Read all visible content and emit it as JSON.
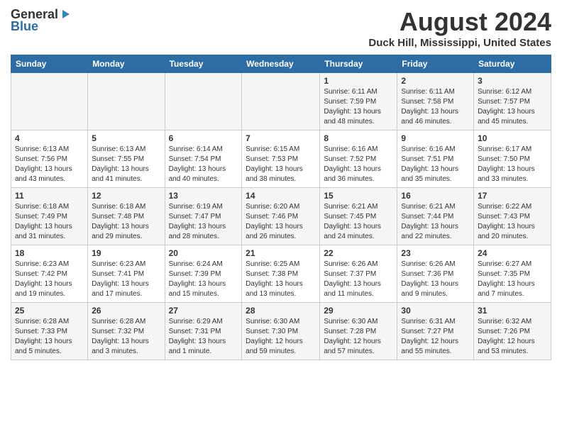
{
  "header": {
    "logo_general": "General",
    "logo_blue": "Blue",
    "month_year": "August 2024",
    "location": "Duck Hill, Mississippi, United States"
  },
  "weekdays": [
    "Sunday",
    "Monday",
    "Tuesday",
    "Wednesday",
    "Thursday",
    "Friday",
    "Saturday"
  ],
  "weeks": [
    [
      {
        "day": "",
        "sunrise": "",
        "sunset": "",
        "daylight": ""
      },
      {
        "day": "",
        "sunrise": "",
        "sunset": "",
        "daylight": ""
      },
      {
        "day": "",
        "sunrise": "",
        "sunset": "",
        "daylight": ""
      },
      {
        "day": "",
        "sunrise": "",
        "sunset": "",
        "daylight": ""
      },
      {
        "day": "1",
        "sunrise": "Sunrise: 6:11 AM",
        "sunset": "Sunset: 7:59 PM",
        "daylight": "Daylight: 13 hours and 48 minutes."
      },
      {
        "day": "2",
        "sunrise": "Sunrise: 6:11 AM",
        "sunset": "Sunset: 7:58 PM",
        "daylight": "Daylight: 13 hours and 46 minutes."
      },
      {
        "day": "3",
        "sunrise": "Sunrise: 6:12 AM",
        "sunset": "Sunset: 7:57 PM",
        "daylight": "Daylight: 13 hours and 45 minutes."
      }
    ],
    [
      {
        "day": "4",
        "sunrise": "Sunrise: 6:13 AM",
        "sunset": "Sunset: 7:56 PM",
        "daylight": "Daylight: 13 hours and 43 minutes."
      },
      {
        "day": "5",
        "sunrise": "Sunrise: 6:13 AM",
        "sunset": "Sunset: 7:55 PM",
        "daylight": "Daylight: 13 hours and 41 minutes."
      },
      {
        "day": "6",
        "sunrise": "Sunrise: 6:14 AM",
        "sunset": "Sunset: 7:54 PM",
        "daylight": "Daylight: 13 hours and 40 minutes."
      },
      {
        "day": "7",
        "sunrise": "Sunrise: 6:15 AM",
        "sunset": "Sunset: 7:53 PM",
        "daylight": "Daylight: 13 hours and 38 minutes."
      },
      {
        "day": "8",
        "sunrise": "Sunrise: 6:16 AM",
        "sunset": "Sunset: 7:52 PM",
        "daylight": "Daylight: 13 hours and 36 minutes."
      },
      {
        "day": "9",
        "sunrise": "Sunrise: 6:16 AM",
        "sunset": "Sunset: 7:51 PM",
        "daylight": "Daylight: 13 hours and 35 minutes."
      },
      {
        "day": "10",
        "sunrise": "Sunrise: 6:17 AM",
        "sunset": "Sunset: 7:50 PM",
        "daylight": "Daylight: 13 hours and 33 minutes."
      }
    ],
    [
      {
        "day": "11",
        "sunrise": "Sunrise: 6:18 AM",
        "sunset": "Sunset: 7:49 PM",
        "daylight": "Daylight: 13 hours and 31 minutes."
      },
      {
        "day": "12",
        "sunrise": "Sunrise: 6:18 AM",
        "sunset": "Sunset: 7:48 PM",
        "daylight": "Daylight: 13 hours and 29 minutes."
      },
      {
        "day": "13",
        "sunrise": "Sunrise: 6:19 AM",
        "sunset": "Sunset: 7:47 PM",
        "daylight": "Daylight: 13 hours and 28 minutes."
      },
      {
        "day": "14",
        "sunrise": "Sunrise: 6:20 AM",
        "sunset": "Sunset: 7:46 PM",
        "daylight": "Daylight: 13 hours and 26 minutes."
      },
      {
        "day": "15",
        "sunrise": "Sunrise: 6:21 AM",
        "sunset": "Sunset: 7:45 PM",
        "daylight": "Daylight: 13 hours and 24 minutes."
      },
      {
        "day": "16",
        "sunrise": "Sunrise: 6:21 AM",
        "sunset": "Sunset: 7:44 PM",
        "daylight": "Daylight: 13 hours and 22 minutes."
      },
      {
        "day": "17",
        "sunrise": "Sunrise: 6:22 AM",
        "sunset": "Sunset: 7:43 PM",
        "daylight": "Daylight: 13 hours and 20 minutes."
      }
    ],
    [
      {
        "day": "18",
        "sunrise": "Sunrise: 6:23 AM",
        "sunset": "Sunset: 7:42 PM",
        "daylight": "Daylight: 13 hours and 19 minutes."
      },
      {
        "day": "19",
        "sunrise": "Sunrise: 6:23 AM",
        "sunset": "Sunset: 7:41 PM",
        "daylight": "Daylight: 13 hours and 17 minutes."
      },
      {
        "day": "20",
        "sunrise": "Sunrise: 6:24 AM",
        "sunset": "Sunset: 7:39 PM",
        "daylight": "Daylight: 13 hours and 15 minutes."
      },
      {
        "day": "21",
        "sunrise": "Sunrise: 6:25 AM",
        "sunset": "Sunset: 7:38 PM",
        "daylight": "Daylight: 13 hours and 13 minutes."
      },
      {
        "day": "22",
        "sunrise": "Sunrise: 6:26 AM",
        "sunset": "Sunset: 7:37 PM",
        "daylight": "Daylight: 13 hours and 11 minutes."
      },
      {
        "day": "23",
        "sunrise": "Sunrise: 6:26 AM",
        "sunset": "Sunset: 7:36 PM",
        "daylight": "Daylight: 13 hours and 9 minutes."
      },
      {
        "day": "24",
        "sunrise": "Sunrise: 6:27 AM",
        "sunset": "Sunset: 7:35 PM",
        "daylight": "Daylight: 13 hours and 7 minutes."
      }
    ],
    [
      {
        "day": "25",
        "sunrise": "Sunrise: 6:28 AM",
        "sunset": "Sunset: 7:33 PM",
        "daylight": "Daylight: 13 hours and 5 minutes."
      },
      {
        "day": "26",
        "sunrise": "Sunrise: 6:28 AM",
        "sunset": "Sunset: 7:32 PM",
        "daylight": "Daylight: 13 hours and 3 minutes."
      },
      {
        "day": "27",
        "sunrise": "Sunrise: 6:29 AM",
        "sunset": "Sunset: 7:31 PM",
        "daylight": "Daylight: 13 hours and 1 minute."
      },
      {
        "day": "28",
        "sunrise": "Sunrise: 6:30 AM",
        "sunset": "Sunset: 7:30 PM",
        "daylight": "Daylight: 12 hours and 59 minutes."
      },
      {
        "day": "29",
        "sunrise": "Sunrise: 6:30 AM",
        "sunset": "Sunset: 7:28 PM",
        "daylight": "Daylight: 12 hours and 57 minutes."
      },
      {
        "day": "30",
        "sunrise": "Sunrise: 6:31 AM",
        "sunset": "Sunset: 7:27 PM",
        "daylight": "Daylight: 12 hours and 55 minutes."
      },
      {
        "day": "31",
        "sunrise": "Sunrise: 6:32 AM",
        "sunset": "Sunset: 7:26 PM",
        "daylight": "Daylight: 12 hours and 53 minutes."
      }
    ]
  ]
}
